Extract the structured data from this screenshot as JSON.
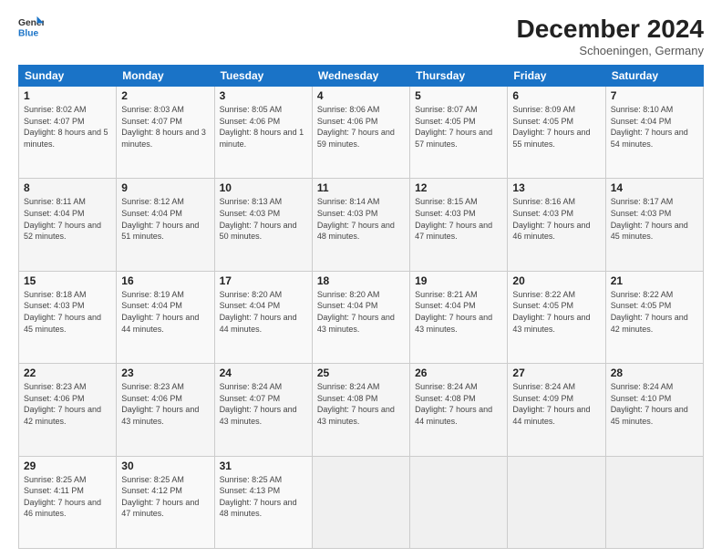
{
  "header": {
    "logo_line1": "General",
    "logo_line2": "Blue",
    "month_title": "December 2024",
    "location": "Schoeningen, Germany"
  },
  "days_of_week": [
    "Sunday",
    "Monday",
    "Tuesday",
    "Wednesday",
    "Thursday",
    "Friday",
    "Saturday"
  ],
  "weeks": [
    [
      {
        "day": 1,
        "sunrise": "Sunrise: 8:02 AM",
        "sunset": "Sunset: 4:07 PM",
        "daylight": "Daylight: 8 hours and 5 minutes."
      },
      {
        "day": 2,
        "sunrise": "Sunrise: 8:03 AM",
        "sunset": "Sunset: 4:07 PM",
        "daylight": "Daylight: 8 hours and 3 minutes."
      },
      {
        "day": 3,
        "sunrise": "Sunrise: 8:05 AM",
        "sunset": "Sunset: 4:06 PM",
        "daylight": "Daylight: 8 hours and 1 minute."
      },
      {
        "day": 4,
        "sunrise": "Sunrise: 8:06 AM",
        "sunset": "Sunset: 4:06 PM",
        "daylight": "Daylight: 7 hours and 59 minutes."
      },
      {
        "day": 5,
        "sunrise": "Sunrise: 8:07 AM",
        "sunset": "Sunset: 4:05 PM",
        "daylight": "Daylight: 7 hours and 57 minutes."
      },
      {
        "day": 6,
        "sunrise": "Sunrise: 8:09 AM",
        "sunset": "Sunset: 4:05 PM",
        "daylight": "Daylight: 7 hours and 55 minutes."
      },
      {
        "day": 7,
        "sunrise": "Sunrise: 8:10 AM",
        "sunset": "Sunset: 4:04 PM",
        "daylight": "Daylight: 7 hours and 54 minutes."
      }
    ],
    [
      {
        "day": 8,
        "sunrise": "Sunrise: 8:11 AM",
        "sunset": "Sunset: 4:04 PM",
        "daylight": "Daylight: 7 hours and 52 minutes."
      },
      {
        "day": 9,
        "sunrise": "Sunrise: 8:12 AM",
        "sunset": "Sunset: 4:04 PM",
        "daylight": "Daylight: 7 hours and 51 minutes."
      },
      {
        "day": 10,
        "sunrise": "Sunrise: 8:13 AM",
        "sunset": "Sunset: 4:03 PM",
        "daylight": "Daylight: 7 hours and 50 minutes."
      },
      {
        "day": 11,
        "sunrise": "Sunrise: 8:14 AM",
        "sunset": "Sunset: 4:03 PM",
        "daylight": "Daylight: 7 hours and 48 minutes."
      },
      {
        "day": 12,
        "sunrise": "Sunrise: 8:15 AM",
        "sunset": "Sunset: 4:03 PM",
        "daylight": "Daylight: 7 hours and 47 minutes."
      },
      {
        "day": 13,
        "sunrise": "Sunrise: 8:16 AM",
        "sunset": "Sunset: 4:03 PM",
        "daylight": "Daylight: 7 hours and 46 minutes."
      },
      {
        "day": 14,
        "sunrise": "Sunrise: 8:17 AM",
        "sunset": "Sunset: 4:03 PM",
        "daylight": "Daylight: 7 hours and 45 minutes."
      }
    ],
    [
      {
        "day": 15,
        "sunrise": "Sunrise: 8:18 AM",
        "sunset": "Sunset: 4:03 PM",
        "daylight": "Daylight: 7 hours and 45 minutes."
      },
      {
        "day": 16,
        "sunrise": "Sunrise: 8:19 AM",
        "sunset": "Sunset: 4:04 PM",
        "daylight": "Daylight: 7 hours and 44 minutes."
      },
      {
        "day": 17,
        "sunrise": "Sunrise: 8:20 AM",
        "sunset": "Sunset: 4:04 PM",
        "daylight": "Daylight: 7 hours and 44 minutes."
      },
      {
        "day": 18,
        "sunrise": "Sunrise: 8:20 AM",
        "sunset": "Sunset: 4:04 PM",
        "daylight": "Daylight: 7 hours and 43 minutes."
      },
      {
        "day": 19,
        "sunrise": "Sunrise: 8:21 AM",
        "sunset": "Sunset: 4:04 PM",
        "daylight": "Daylight: 7 hours and 43 minutes."
      },
      {
        "day": 20,
        "sunrise": "Sunrise: 8:22 AM",
        "sunset": "Sunset: 4:05 PM",
        "daylight": "Daylight: 7 hours and 43 minutes."
      },
      {
        "day": 21,
        "sunrise": "Sunrise: 8:22 AM",
        "sunset": "Sunset: 4:05 PM",
        "daylight": "Daylight: 7 hours and 42 minutes."
      }
    ],
    [
      {
        "day": 22,
        "sunrise": "Sunrise: 8:23 AM",
        "sunset": "Sunset: 4:06 PM",
        "daylight": "Daylight: 7 hours and 42 minutes."
      },
      {
        "day": 23,
        "sunrise": "Sunrise: 8:23 AM",
        "sunset": "Sunset: 4:06 PM",
        "daylight": "Daylight: 7 hours and 43 minutes."
      },
      {
        "day": 24,
        "sunrise": "Sunrise: 8:24 AM",
        "sunset": "Sunset: 4:07 PM",
        "daylight": "Daylight: 7 hours and 43 minutes."
      },
      {
        "day": 25,
        "sunrise": "Sunrise: 8:24 AM",
        "sunset": "Sunset: 4:08 PM",
        "daylight": "Daylight: 7 hours and 43 minutes."
      },
      {
        "day": 26,
        "sunrise": "Sunrise: 8:24 AM",
        "sunset": "Sunset: 4:08 PM",
        "daylight": "Daylight: 7 hours and 44 minutes."
      },
      {
        "day": 27,
        "sunrise": "Sunrise: 8:24 AM",
        "sunset": "Sunset: 4:09 PM",
        "daylight": "Daylight: 7 hours and 44 minutes."
      },
      {
        "day": 28,
        "sunrise": "Sunrise: 8:24 AM",
        "sunset": "Sunset: 4:10 PM",
        "daylight": "Daylight: 7 hours and 45 minutes."
      }
    ],
    [
      {
        "day": 29,
        "sunrise": "Sunrise: 8:25 AM",
        "sunset": "Sunset: 4:11 PM",
        "daylight": "Daylight: 7 hours and 46 minutes."
      },
      {
        "day": 30,
        "sunrise": "Sunrise: 8:25 AM",
        "sunset": "Sunset: 4:12 PM",
        "daylight": "Daylight: 7 hours and 47 minutes."
      },
      {
        "day": 31,
        "sunrise": "Sunrise: 8:25 AM",
        "sunset": "Sunset: 4:13 PM",
        "daylight": "Daylight: 7 hours and 48 minutes."
      },
      null,
      null,
      null,
      null
    ]
  ]
}
